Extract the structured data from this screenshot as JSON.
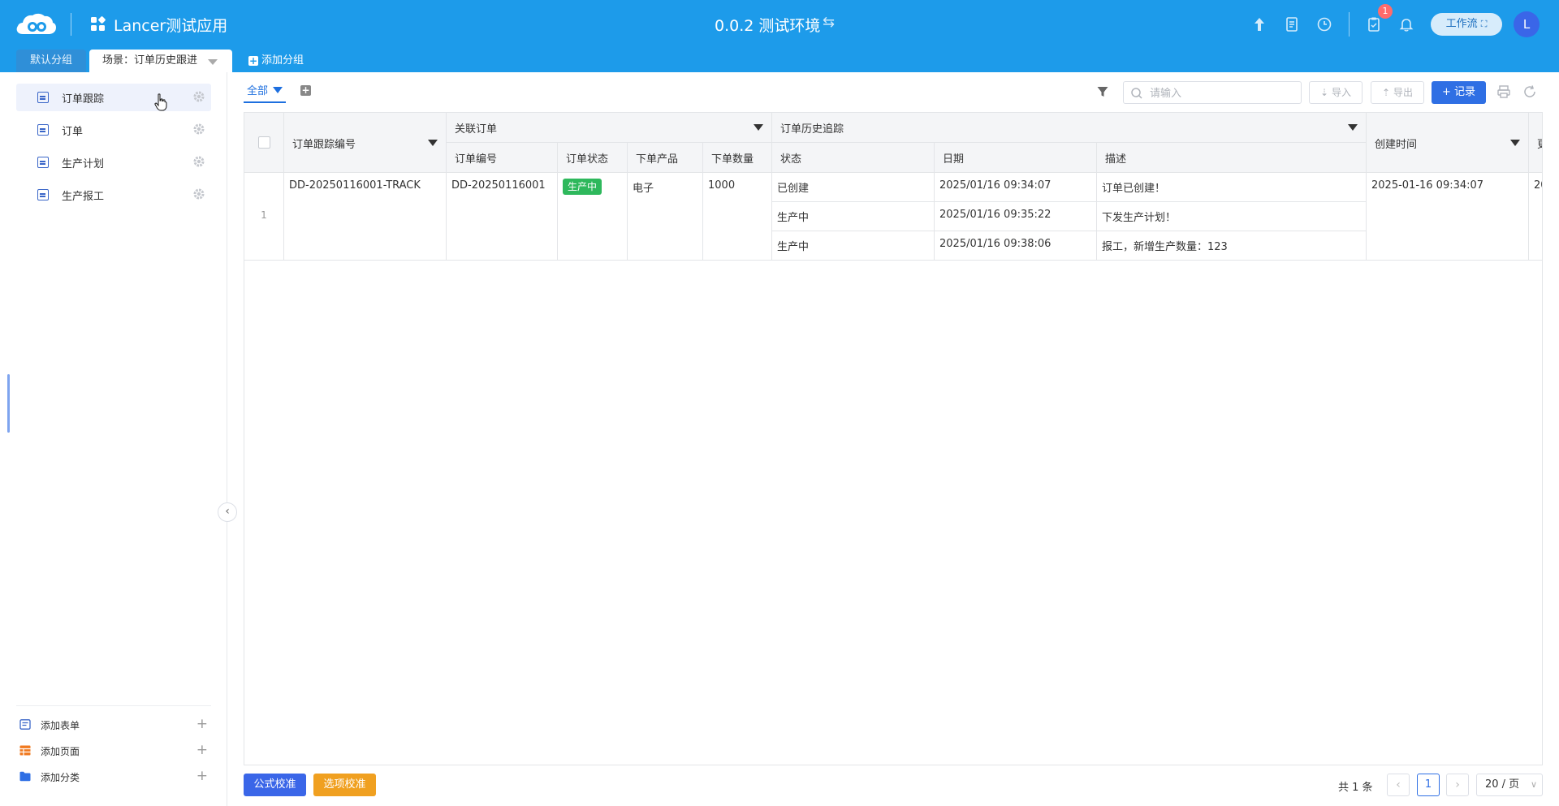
{
  "header": {
    "app_title": "Lancer测试应用",
    "env_title": "0.0.2 测试环境",
    "env_switch_glyph": "⇆",
    "notification_count": "1",
    "workflow_label": "工作流",
    "avatar_initial": "L"
  },
  "tabs": {
    "default_group": "默认分组",
    "scene_group": "场景：订单历史跟进",
    "add_group": "添加分组"
  },
  "sidebar": {
    "items": [
      {
        "label": "订单跟踪"
      },
      {
        "label": "订单"
      },
      {
        "label": "生产计划"
      },
      {
        "label": "生产报工"
      }
    ],
    "collapse_glyph": "‹",
    "add_form": "添加表单",
    "add_page": "添加页面",
    "add_category": "添加分类"
  },
  "toolbar": {
    "view_tab": "全部",
    "search_placeholder": "请输入",
    "import_label": "导入",
    "export_label": "导出",
    "record_label": "+ 记录"
  },
  "table": {
    "headers": {
      "track_no": "订单跟踪编号",
      "linked_order": "关联订单",
      "order_no": "订单编号",
      "order_status": "订单状态",
      "product": "下单产品",
      "quantity": "下单数量",
      "history": "订单历史追踪",
      "status": "状态",
      "date": "日期",
      "desc": "描述",
      "created": "创建时间",
      "next_col_partial": "更"
    },
    "rows": [
      {
        "row_num": "1",
        "track_no": "DD-20250116001-TRACK",
        "order_no": "DD-20250116001",
        "order_status": "生产中",
        "product": "电子",
        "quantity": "1000",
        "created": "2025-01-16 09:34:07",
        "next_partial": "20",
        "history": [
          {
            "status": "已创建",
            "date": "2025/01/16 09:34:07",
            "desc": "订单已创建！"
          },
          {
            "status": "生产中",
            "date": "2025/01/16 09:35:22",
            "desc": "下发生产计划！"
          },
          {
            "status": "生产中",
            "date": "2025/01/16 09:38:06",
            "desc": "报工，新增生产数量：123"
          }
        ]
      }
    ]
  },
  "footer": {
    "formula_check": "公式校准",
    "option_check": "选项校准",
    "total": "共 1 条",
    "current_page": "1",
    "page_size": "20 / 页"
  },
  "colors": {
    "header_bg": "#1d9bea",
    "primary": "#2f6fe4",
    "status_green": "#2eb85c",
    "warning_orange": "#f0a020",
    "badge_red": "#ff6b6b"
  }
}
